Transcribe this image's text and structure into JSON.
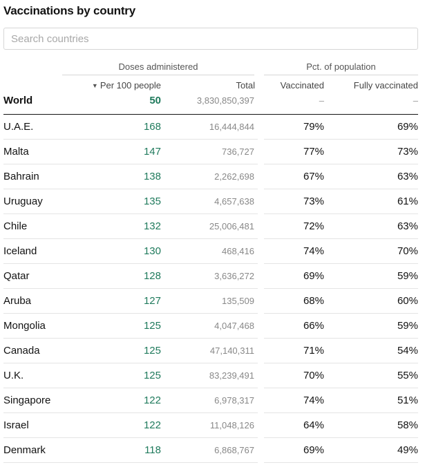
{
  "title": "Vaccinations by country",
  "search": {
    "placeholder": "Search countries",
    "value": ""
  },
  "header": {
    "group1": "Doses administered",
    "group2": "Pct. of population",
    "sort_arrow": "▼",
    "col_per100": "Per 100 people",
    "col_total": "Total",
    "col_vaccinated": "Vaccinated",
    "col_fully": "Fully vaccinated"
  },
  "world": {
    "country": "World",
    "per100": "50",
    "total": "3,830,850,397",
    "vaccinated": "–",
    "fully": "–"
  },
  "rows": [
    {
      "country": "U.A.E.",
      "per100": "168",
      "total": "16,444,844",
      "vaccinated": "79%",
      "fully": "69%"
    },
    {
      "country": "Malta",
      "per100": "147",
      "total": "736,727",
      "vaccinated": "77%",
      "fully": "73%"
    },
    {
      "country": "Bahrain",
      "per100": "138",
      "total": "2,262,698",
      "vaccinated": "67%",
      "fully": "63%"
    },
    {
      "country": "Uruguay",
      "per100": "135",
      "total": "4,657,638",
      "vaccinated": "73%",
      "fully": "61%"
    },
    {
      "country": "Chile",
      "per100": "132",
      "total": "25,006,481",
      "vaccinated": "72%",
      "fully": "63%"
    },
    {
      "country": "Iceland",
      "per100": "130",
      "total": "468,416",
      "vaccinated": "74%",
      "fully": "70%"
    },
    {
      "country": "Qatar",
      "per100": "128",
      "total": "3,636,272",
      "vaccinated": "69%",
      "fully": "59%"
    },
    {
      "country": "Aruba",
      "per100": "127",
      "total": "135,509",
      "vaccinated": "68%",
      "fully": "60%"
    },
    {
      "country": "Mongolia",
      "per100": "125",
      "total": "4,047,468",
      "vaccinated": "66%",
      "fully": "59%"
    },
    {
      "country": "Canada",
      "per100": "125",
      "total": "47,140,311",
      "vaccinated": "71%",
      "fully": "54%"
    },
    {
      "country": "U.K.",
      "per100": "125",
      "total": "83,239,491",
      "vaccinated": "70%",
      "fully": "55%"
    },
    {
      "country": "Singapore",
      "per100": "122",
      "total": "6,978,317",
      "vaccinated": "74%",
      "fully": "51%"
    },
    {
      "country": "Israel",
      "per100": "122",
      "total": "11,048,126",
      "vaccinated": "64%",
      "fully": "58%"
    },
    {
      "country": "Denmark",
      "per100": "118",
      "total": "6,868,767",
      "vaccinated": "69%",
      "fully": "49%"
    }
  ],
  "colors": {
    "per100": "#1f7a5c",
    "total": "#888888",
    "rule": "#e4e4e4"
  }
}
